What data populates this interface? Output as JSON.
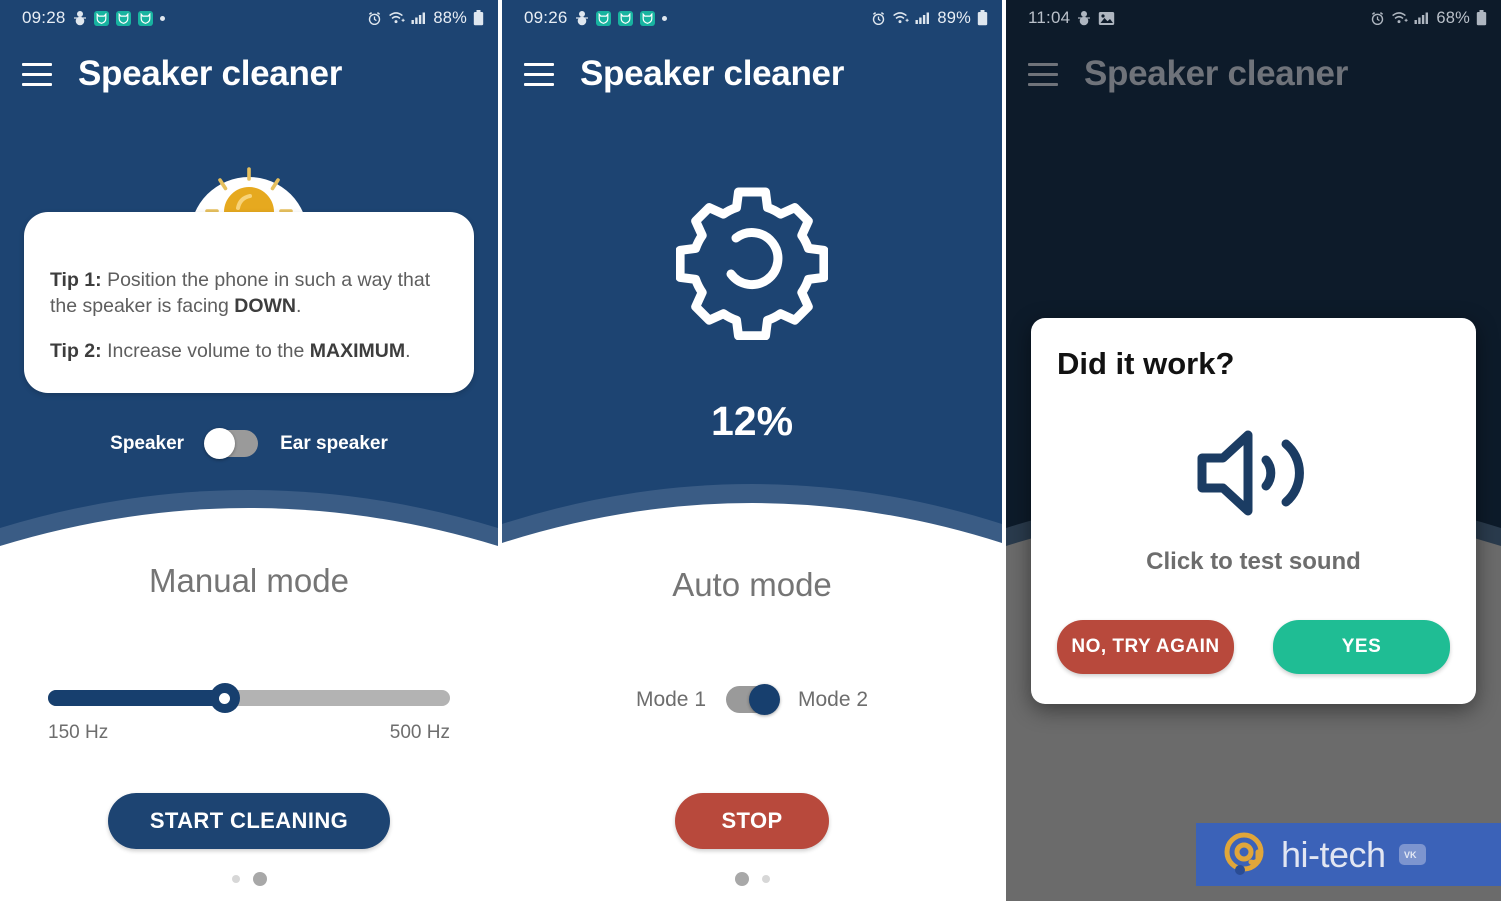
{
  "panels": [
    {
      "id": "manual",
      "statusbar": {
        "time": "09:28",
        "battery": "88%",
        "icons": [
          "snowman-icon",
          "cat-shield-icon",
          "cat-shield-icon",
          "cat-shield-icon",
          "dot-icon",
          "alarm-icon",
          "wifi-icon",
          "signal-icon",
          "battery-icon"
        ]
      },
      "appbar": {
        "title": "Speaker cleaner",
        "menu_icon": "hamburger-icon"
      },
      "tip_card": {
        "bulb_icon": "lightbulb-icon",
        "tip1_label": "Tip 1:",
        "tip1_text_a": " Position the phone in such a way that the speaker is facing ",
        "tip1_strong": "DOWN",
        "tip1_text_b": ".",
        "tip2_label": "Tip 2:",
        "tip2_text_a": " Increase volume to the ",
        "tip2_strong": "MAXIMUM",
        "tip2_text_b": "."
      },
      "speaker_toggle": {
        "left_label": "Speaker",
        "right_label": "Ear speaker",
        "state": "off"
      },
      "mode_title": "Manual mode",
      "slider": {
        "min_label": "150 Hz",
        "max_label": "500 Hz",
        "value_percent": 44
      },
      "action_button": "START CLEANING",
      "page_dots": {
        "count": 2,
        "active_index": 1
      }
    },
    {
      "id": "auto",
      "statusbar": {
        "time": "09:26",
        "battery": "89%",
        "icons": [
          "snowman-icon",
          "cat-shield-icon",
          "cat-shield-icon",
          "cat-shield-icon",
          "dot-icon",
          "alarm-icon",
          "wifi-icon",
          "signal-icon",
          "battery-icon"
        ]
      },
      "appbar": {
        "title": "Speaker cleaner",
        "menu_icon": "hamburger-icon"
      },
      "progress": {
        "gear_icon": "gear-refresh-icon",
        "percent_label": "12%",
        "percent_value": 12
      },
      "mode_switch": {
        "left_label": "Mode 1",
        "right_label": "Mode 2",
        "state": "on"
      },
      "mode_title": "Auto mode",
      "action_button": "STOP",
      "page_dots": {
        "count": 2,
        "active_index": 0
      }
    },
    {
      "id": "dialog",
      "statusbar": {
        "time": "11:04",
        "battery": "68%",
        "icons": [
          "snowman-icon",
          "image-icon",
          "alarm-icon",
          "wifi-icon",
          "signal-icon",
          "battery-icon"
        ]
      },
      "appbar": {
        "title": "Speaker cleaner",
        "menu_icon": "hamburger-icon"
      },
      "dialog": {
        "title": "Did it work?",
        "speaker_icon": "speaker-volume-icon",
        "subtitle": "Click to test sound",
        "no_button": "NO, TRY AGAIN",
        "yes_button": "YES"
      }
    }
  ],
  "watermark": {
    "at_icon": "at-logo-icon",
    "text": "hi-tech",
    "vk_badge": "VK"
  },
  "colors": {
    "navy": "#1d4472",
    "navy_dark": "#173f6e",
    "navy_light_arc": "#3a5c85",
    "red": "#b8493c",
    "green": "#1fbd94",
    "teal": "#18b3a0",
    "amber": "#e6a91f",
    "gray_text": "#6d6d6d",
    "scrim_dark": "#0d1b2a",
    "scrim_gray": "#6b6b6b",
    "watermark_blue": "#3b62b8"
  }
}
